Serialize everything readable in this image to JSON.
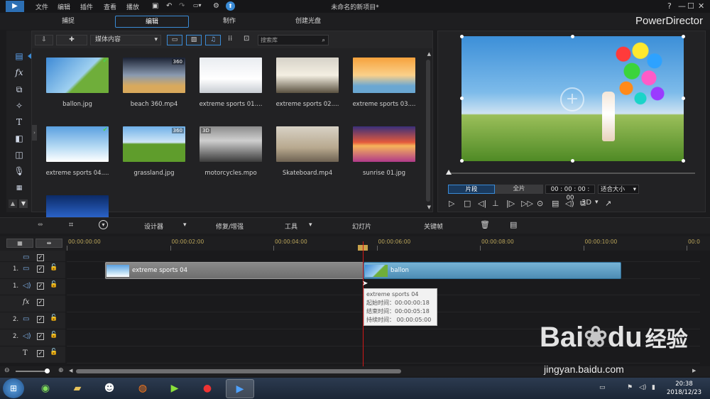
{
  "menubar": {
    "items": [
      "文件",
      "编辑",
      "插件",
      "查看",
      "播放"
    ],
    "title": "未命名的新项目*",
    "help": "?",
    "minimize": "—",
    "maximize": "☐",
    "close": "✕"
  },
  "tabs": [
    "捕捉",
    "编辑",
    "制作",
    "创建光盘"
  ],
  "active_tab": "编辑",
  "brand": "PowerDirector",
  "library": {
    "dropdown": "媒体内容",
    "search_placeholder": "搜索库",
    "items": [
      {
        "label": "ballon.jpg",
        "check": "✔",
        "gradient": "linear-gradient(135deg,#3e8ad6,#9fd0f0 55%,#6fae3a 60%)"
      },
      {
        "label": "beach 360.mp4",
        "badge": "360",
        "gradient": "linear-gradient(180deg,#1b2233,#8a9ab0 50%,#d9a95c 80%)"
      },
      {
        "label": "extreme sports 01....",
        "gradient": "linear-gradient(180deg,#e9ecf0,#ffffff 60%,#c7ccd2)"
      },
      {
        "label": "extreme sports 02....",
        "gradient": "linear-gradient(180deg,#d6d2c8,#f4efe2 50%,#5a5140)"
      },
      {
        "label": "extreme sports 03....",
        "gradient": "linear-gradient(180deg,#f6a23c,#fbd08a 50%,#6aa7d2 80%)"
      },
      {
        "label": "extreme sports 04....",
        "check": "✔",
        "gradient": "linear-gradient(180deg,#5aa0e0,#b9dcf4 60%,#ffffff)"
      },
      {
        "label": "grassland.jpg",
        "badge": "360",
        "gradient": "linear-gradient(180deg,#6fb0e8,#cfe6f7 45%,#5f9d2c 50%)"
      },
      {
        "label": "motorcycles.mpo",
        "badge": "3D",
        "gradient": "linear-gradient(180deg,#8c8c8c,#cfcfcf 40%,#3c3c3c)"
      },
      {
        "label": "Skateboard.mp4",
        "gradient": "linear-gradient(180deg,#d8d2c6,#b8a98f 60%,#6e6252)"
      },
      {
        "label": "sunrise 01.jpg",
        "gradient": "linear-gradient(180deg,#3a2f7a,#e45a3c 45%,#f6b45a 55%,#b03a8a)"
      },
      {
        "label": "",
        "gradient": "linear-gradient(180deg,#0b2a66,#2e6ad4 70%,#6fb2f2)"
      }
    ]
  },
  "preview": {
    "mode_clip": "片段",
    "mode_movie": "全片",
    "timecode": "00 : 00 : 00 : 00",
    "fit": "适合大小",
    "stereo": "3D"
  },
  "timeline_toolbar": {
    "designer": "设计器",
    "fix": "修复/增强",
    "tools": "工具",
    "slideshow": "幻灯片",
    "keyframe": "关键帧"
  },
  "ruler": [
    "00:00:00:00",
    "00:00:02:00",
    "00:00:04:00",
    "00:00:06:00",
    "00:00:08:00",
    "00:00:10:00",
    "00:0"
  ],
  "tracks": [
    {
      "num": "",
      "icon": "▭"
    },
    {
      "num": "1.",
      "icon": "▭"
    },
    {
      "num": "1.",
      "icon": "◁)"
    },
    {
      "num": "",
      "icon": "fx"
    },
    {
      "num": "2.",
      "icon": "▭"
    },
    {
      "num": "2.",
      "icon": "◁)"
    },
    {
      "num": "",
      "icon": "T"
    }
  ],
  "clips": {
    "clip1": "extreme sports 04",
    "clip2": "ballon"
  },
  "tooltip": {
    "name": "extreme sports 04",
    "start": "起始时间：00:00:00:18",
    "end": "结束时间：00:00:05:18",
    "duration": "持续时间：  00:00:05:00"
  },
  "taskbar": {
    "time": "20:38",
    "date": "2018/12/23"
  },
  "watermark": {
    "logo": "Bai",
    "logo2": "du",
    "logo3": "经验",
    "url": "jingyan.baidu.com"
  },
  "colors": {
    "accent": "#3a8bd6",
    "playhead": "#d01818",
    "clip_blue": "#5d9ec4"
  }
}
